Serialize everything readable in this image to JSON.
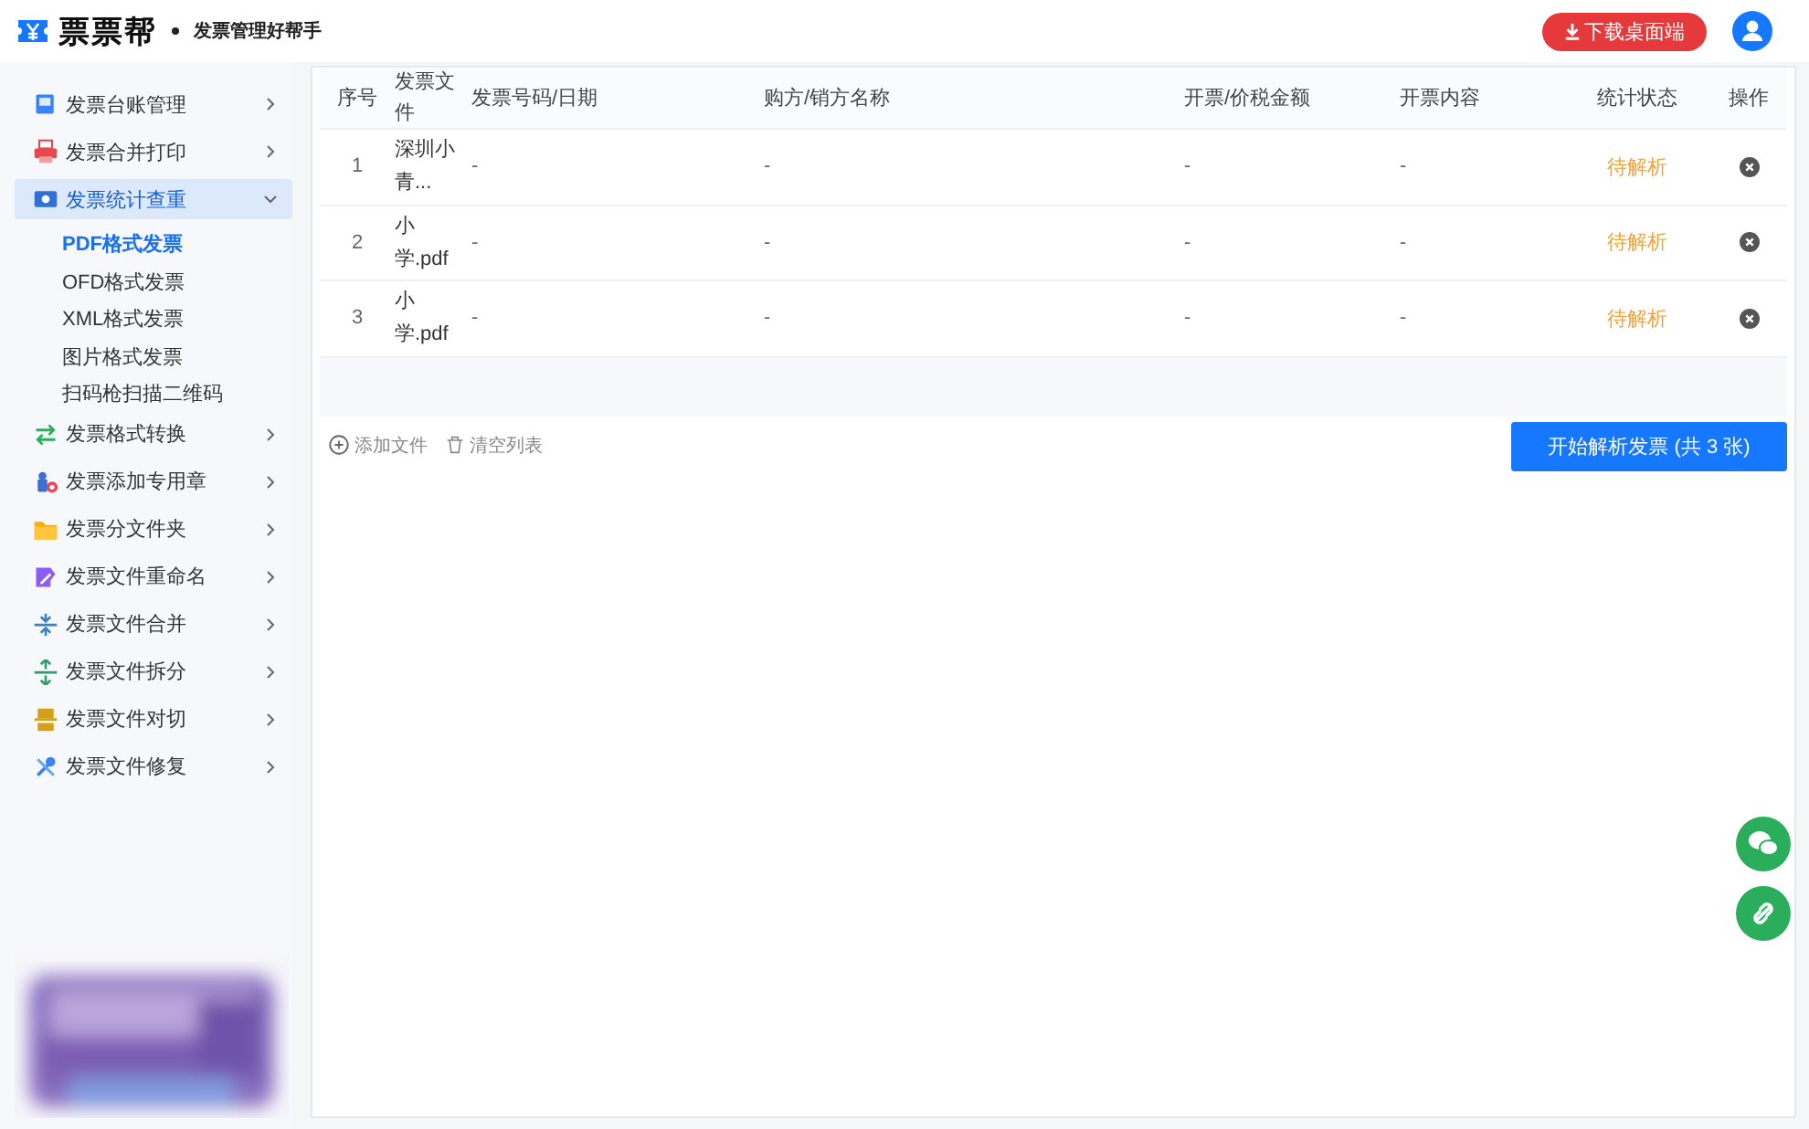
{
  "header": {
    "brand": "票票帮",
    "tagline": "发票管理好帮手",
    "download_button": "下载桌面端"
  },
  "sidebar": {
    "items": [
      {
        "label": "发票台账管理",
        "selected": false,
        "expanded": false
      },
      {
        "label": "发票合并打印",
        "selected": false,
        "expanded": false
      },
      {
        "label": "发票统计查重",
        "selected": true,
        "expanded": true,
        "children": [
          {
            "label": "PDF格式发票",
            "selected": true
          },
          {
            "label": "OFD格式发票",
            "selected": false
          },
          {
            "label": "XML格式发票",
            "selected": false
          },
          {
            "label": "图片格式发票",
            "selected": false
          },
          {
            "label": "扫码枪扫描二维码",
            "selected": false
          }
        ]
      },
      {
        "label": "发票格式转换",
        "selected": false,
        "expanded": false
      },
      {
        "label": "发票添加专用章",
        "selected": false,
        "expanded": false
      },
      {
        "label": "发票分文件夹",
        "selected": false,
        "expanded": false
      },
      {
        "label": "发票文件重命名",
        "selected": false,
        "expanded": false
      },
      {
        "label": "发票文件合并",
        "selected": false,
        "expanded": false
      },
      {
        "label": "发票文件拆分",
        "selected": false,
        "expanded": false
      },
      {
        "label": "发票文件对切",
        "selected": false,
        "expanded": false
      },
      {
        "label": "发票文件修复",
        "selected": false,
        "expanded": false
      }
    ]
  },
  "table": {
    "columns": [
      "序号",
      "发票文件",
      "发票号码/日期",
      "购方/销方名称",
      "开票/价税金额",
      "开票内容",
      "统计状态",
      "操作"
    ],
    "rows": [
      {
        "index": "1",
        "file": "深圳小青...",
        "number_date": "-",
        "parties": "-",
        "amount": "-",
        "content": "-",
        "status": "待解析"
      },
      {
        "index": "2",
        "file": "小学.pdf",
        "number_date": "-",
        "parties": "-",
        "amount": "-",
        "content": "-",
        "status": "待解析"
      },
      {
        "index": "3",
        "file": "小学.pdf",
        "number_date": "-",
        "parties": "-",
        "amount": "-",
        "content": "-",
        "status": "待解析"
      }
    ]
  },
  "actions": {
    "add_file": "添加文件",
    "clear_list": "清空列表",
    "start_button": "开始解析发票 (共 3 张)"
  }
}
